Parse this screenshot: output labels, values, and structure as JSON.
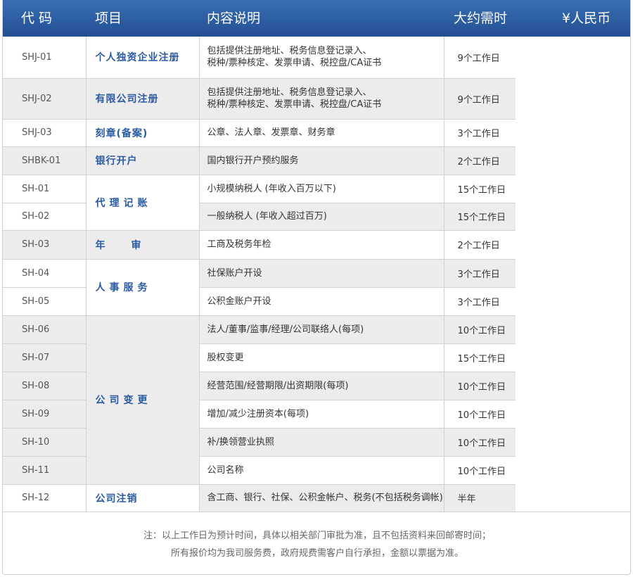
{
  "header": {
    "code": "代 码",
    "project": "项目",
    "description": "内容说明",
    "time": "大约需时",
    "price": "¥人民币"
  },
  "rows": [
    {
      "code": "SHJ-01",
      "project": "个人独资企业注册",
      "desc1": "包括提供注册地址、税务信息登记录入、",
      "desc2": "税种/票种核定、发票申请、税控盘/CA证书",
      "time": "9个工作日"
    },
    {
      "code": "SHJ-02",
      "project": "有限公司注册",
      "desc1": "包括提供注册地址、税务信息登记录入、",
      "desc2": "税种/票种核定、发票申请、税控盘/CA证书",
      "time": "9个工作日"
    },
    {
      "code": "SHJ-03",
      "project": "刻章(备案)",
      "desc": "公章、法人章、发票章、财务章",
      "time": "3个工作日"
    },
    {
      "code": "SHBK-01",
      "project": "银行开户",
      "desc": "国内银行开户预约服务",
      "time": "2个工作日"
    },
    {
      "code": "SH-01",
      "project": "代理记账",
      "desc": "小规模纳税人 (年收入百万以下)",
      "time": "15个工作日"
    },
    {
      "code": "SH-02",
      "desc": "一般纳税人 (年收入超过百万)",
      "time": "15个工作日"
    },
    {
      "code": "SH-03",
      "project": "年 审",
      "desc": "工商及税务年检",
      "time": "2个工作日"
    },
    {
      "code": "SH-04",
      "project": "人事服务",
      "desc": "社保账户开设",
      "time": "3个工作日"
    },
    {
      "code": "SH-05",
      "desc": "公积金账户开设",
      "time": "3个工作日"
    },
    {
      "code": "SH-06",
      "project": "公司变更",
      "desc": "法人/董事/监事/经理/公司联络人(每项)",
      "time": "10个工作日"
    },
    {
      "code": "SH-07",
      "desc": "股权变更",
      "time": "15个工作日"
    },
    {
      "code": "SH-08",
      "desc": "经营范围/经营期限/出资期限(每项)",
      "time": "10个工作日"
    },
    {
      "code": "SH-09",
      "desc": "增加/减少注册资本(每项)",
      "time": "10个工作日"
    },
    {
      "code": "SH-10",
      "desc": "补/换领营业执照",
      "time": "10个工作日"
    },
    {
      "code": "SH-11",
      "desc": "公司名称",
      "time": "10个工作日"
    },
    {
      "code": "SH-12",
      "project": "公司注销",
      "desc": "含工商、银行、社保、公积金帐户、税务(不包括税务调帐)",
      "time": "半年"
    }
  ],
  "note": {
    "line1": "注：以上工作日为预计时间，具体以相关部门审批为准，且不包括资料来回邮寄时间；",
    "line2": "所有报价均为我司服务费，政府规费需客户自行承担，金额以票据为准。"
  }
}
